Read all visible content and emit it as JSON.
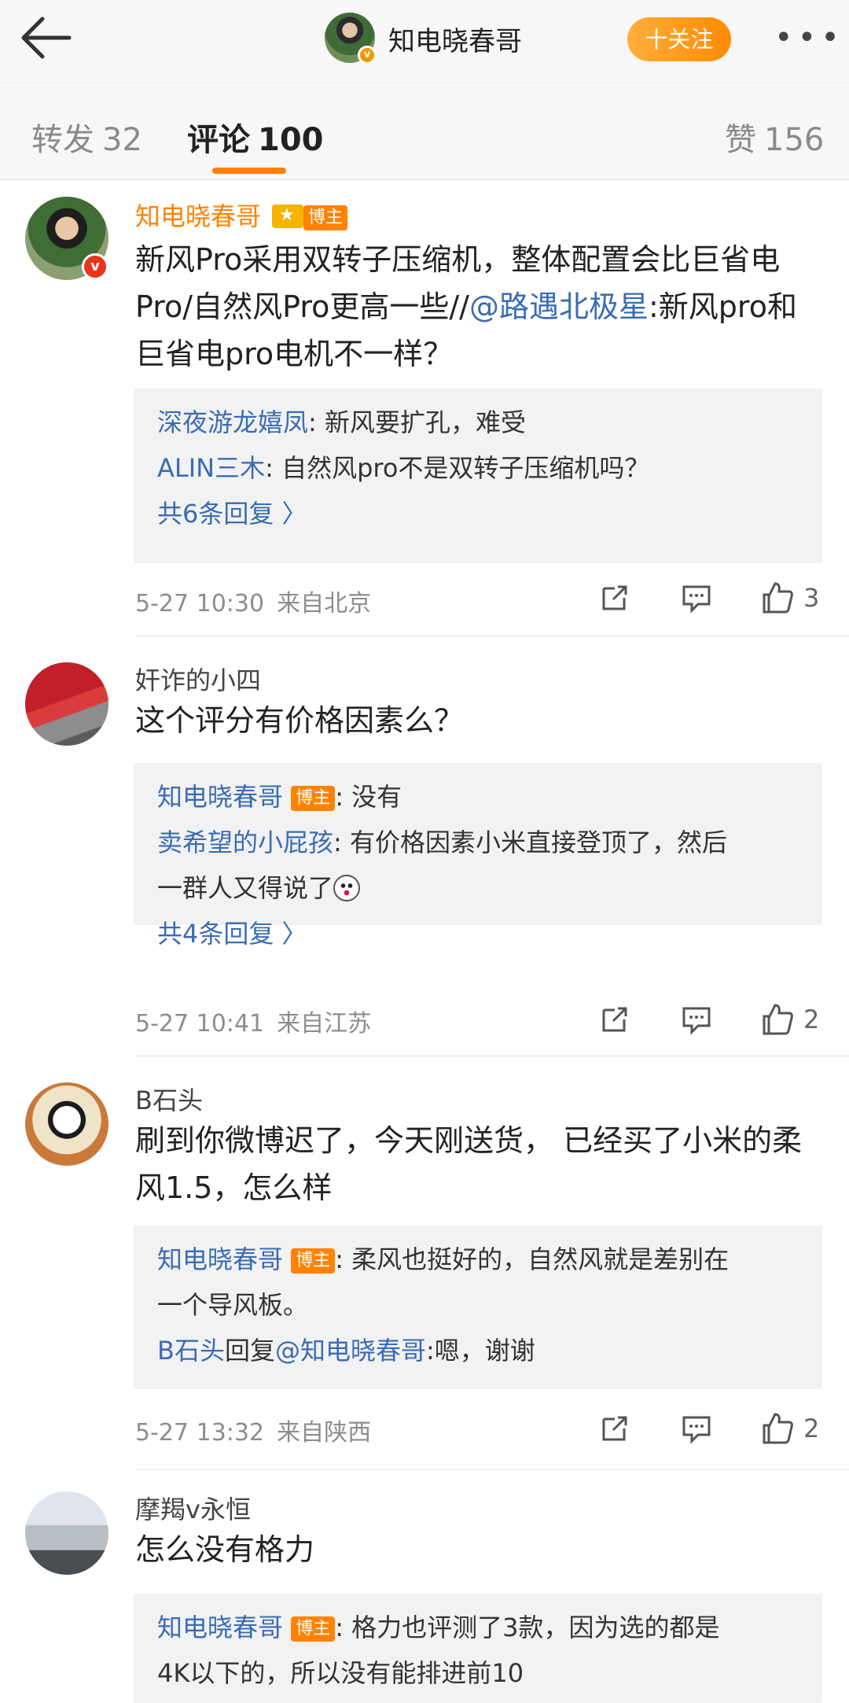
{
  "header": {
    "title": "知电晓春哥",
    "follow_label": "十关注",
    "more_label": "•••"
  },
  "tabs": [
    {
      "label": "转发",
      "count": "32"
    },
    {
      "label": "评论",
      "count": "100"
    },
    {
      "label": "赞",
      "count": "156"
    }
  ],
  "host_tag": "博主",
  "comments": [
    {
      "author": "知电晓春哥",
      "text_a": "新风Pro采用双转子压缩机，整体配置会比巨省电Pro/自然风Pro更高一些//",
      "mention": "@路遇北极星",
      "text_b": ":新风pro和巨省电pro电机不一样？",
      "replies": [
        {
          "who": "深夜游龙嬉凤",
          "text": ": 新风要扩孔，难受"
        },
        {
          "who": "ALIN三木",
          "text": ": 自然风pro不是双转子压缩机吗？"
        }
      ],
      "more_replies": "共6条回复 〉",
      "time": "5-27 10:30",
      "location": "来自北京",
      "likes": "3"
    },
    {
      "author": "奸诈的小四",
      "text": "这个评分有价格因素么？",
      "replies": [
        {
          "who": "知电晓春哥",
          "text": ": 没有"
        },
        {
          "who": "卖希望的小屁孩",
          "text": ": 有价格因素小米直接登顶了，然后",
          "text2": "一群人又得说了"
        }
      ],
      "more_replies": "共4条回复 〉",
      "time": "5-27 10:41",
      "location": "来自江苏",
      "likes": "2"
    },
    {
      "author": "B石头",
      "text": "刷到你微博迟了，今天刚送货， 已经买了小米的柔风1.5，怎么样",
      "replies": [
        {
          "who": "知电晓春哥",
          "text": ": 柔风也挺好的，自然风就是差别在",
          "text2": "一个导风板。"
        },
        {
          "who": "B石头",
          "mid": "回复",
          "who2": "@知电晓春哥",
          "text": ":嗯，谢谢"
        }
      ],
      "time": "5-27 13:32",
      "location": "来自陕西",
      "likes": "2"
    },
    {
      "author": "摩羯v永恒",
      "text": "怎么没有格力",
      "replies": [
        {
          "who": "知电晓春哥",
          "text": ": 格力也评测了3款，因为选的都是",
          "text2": "4K以下的，所以没有能排进前10"
        }
      ]
    }
  ]
}
